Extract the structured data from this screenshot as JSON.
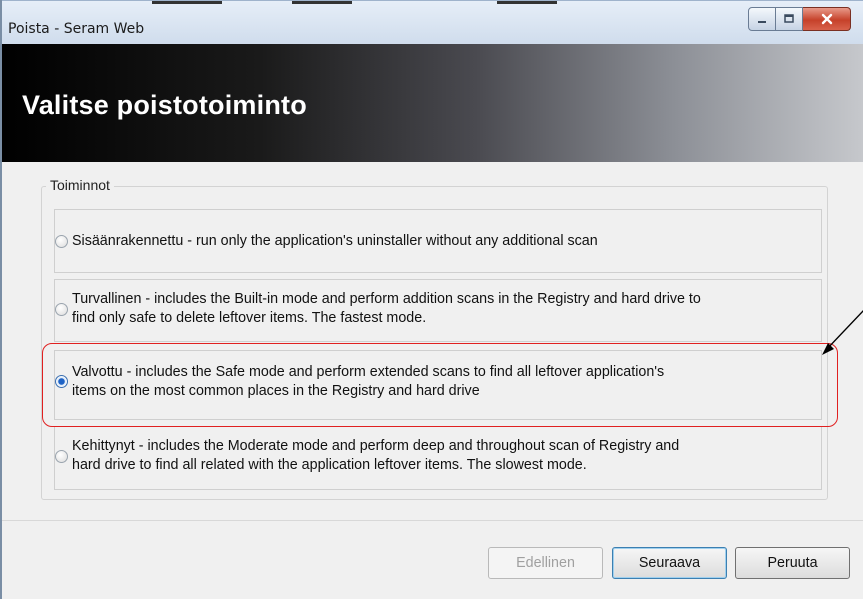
{
  "window": {
    "title": "Poista - Seram Web"
  },
  "banner": {
    "title": "Valitse poistotoiminto"
  },
  "group": {
    "legend": "Toiminnot",
    "options": [
      {
        "line1": "Sisäänrakennettu - run only the application's uninstaller without any additional scan",
        "line2": "",
        "selected": false
      },
      {
        "line1": "Turvallinen - includes the Built-in mode and perform addition scans in the Registry and hard drive to",
        "line2": "find only safe to delete leftover items. The fastest mode.",
        "selected": false
      },
      {
        "line1": "Valvottu - includes the Safe mode and perform extended scans to find all leftover application's",
        "line2": "items on the most common places in the Registry and hard drive",
        "selected": true
      },
      {
        "line1": "Kehittynyt - includes the Moderate mode and perform deep and throughout scan of Registry and",
        "line2": "hard drive to find all related with the application leftover items. The slowest mode.",
        "selected": false
      }
    ]
  },
  "buttons": {
    "back": "Edellinen",
    "next": "Seuraava",
    "cancel": "Peruuta"
  },
  "colors": {
    "highlight": "#e02020",
    "close_button": "#c6412a"
  }
}
